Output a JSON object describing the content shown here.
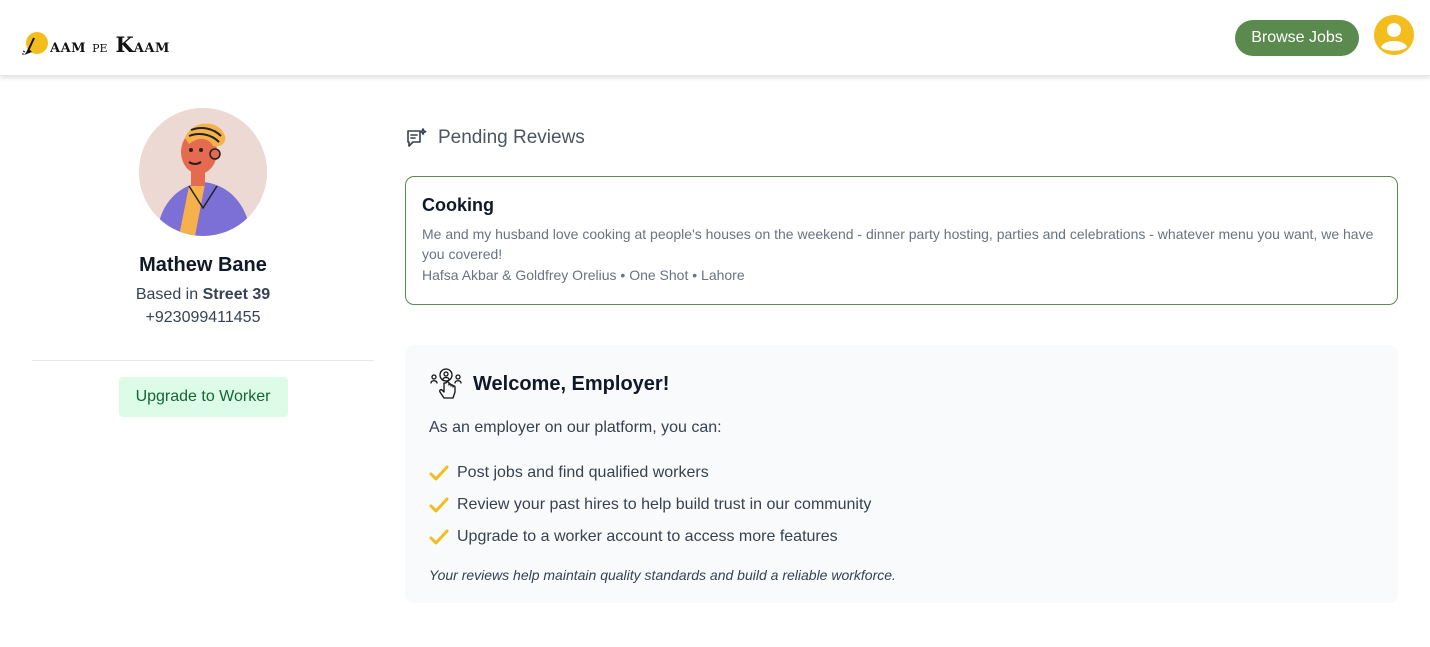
{
  "header": {
    "logo": {
      "part1_first": "D",
      "part1_rest": "AAM",
      "connector": "PE",
      "part2_first": "K",
      "part2_rest": "AAM"
    },
    "browse_jobs_label": "Browse Jobs",
    "user_icon": "user-circle-icon"
  },
  "profile": {
    "name": "Mathew Bane",
    "based_in_prefix": "Based in",
    "location": "Street 39",
    "phone": "+923099411455",
    "upgrade_label": "Upgrade to Worker"
  },
  "pending_reviews": {
    "icon": "chat-review-icon",
    "title": "Pending Reviews",
    "items": [
      {
        "title": "Cooking",
        "description": "Me and my husband love cooking at people's houses on the weekend - dinner party hosting, parties and celebrations - whatever menu you want, we have you covered!",
        "meta": "Hafsa Akbar & Goldfrey Orelius • One Shot • Lahore"
      }
    ]
  },
  "welcome": {
    "icon": "hire-pointer-icon",
    "title": "Welcome, Employer!",
    "intro": "As an employer on our platform, you can:",
    "benefits": [
      "Post jobs and find qualified workers",
      "Review your past hires to help build trust in our community",
      "Upgrade to a worker account to access more features"
    ],
    "note": "Your reviews help maintain quality standards and build a reliable workforce."
  },
  "colors": {
    "brand_green": "#5b8a4f",
    "accent_yellow": "#f3bd1e",
    "upgrade_bg": "#dcfce7",
    "upgrade_text": "#166534"
  }
}
